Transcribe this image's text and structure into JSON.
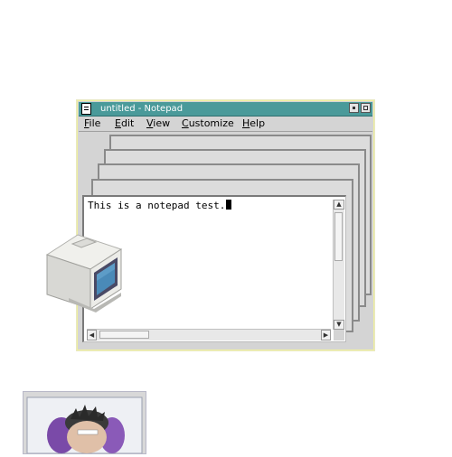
{
  "window": {
    "title": "untitled - Notepad"
  },
  "menu": {
    "items": [
      "File",
      "Edit",
      "View",
      "Customize",
      "Help"
    ]
  },
  "editor": {
    "text": "This is a notepad test."
  },
  "icons": {
    "system_menu": "window-menu-icon",
    "minimize": "minimize-icon",
    "maximize": "maximize-icon",
    "desktop_computer": "computer-monitor-icon",
    "photo": "person-photo-icon"
  },
  "colors": {
    "titlebar": "#4a9a9a",
    "window": "#d4d4d4",
    "editor_bg": "#ffffff"
  }
}
